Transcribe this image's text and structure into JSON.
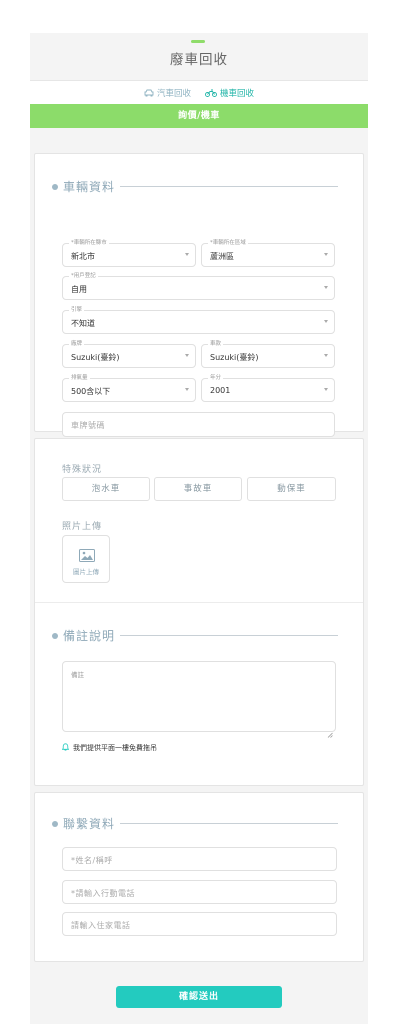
{
  "header": {
    "title": "廢車回收"
  },
  "tabs": {
    "car": "汽車回收",
    "motorcycle": "機車回收"
  },
  "banner": {
    "text": "詢價/機車"
  },
  "vehicle": {
    "heading": "車輛資料",
    "city": {
      "label": "*車輛所在縣市",
      "value": "新北市"
    },
    "district": {
      "label": "*車輛所在區域",
      "value": "蘆洲區"
    },
    "user_type": {
      "label": "*用戶登記",
      "value": "自用"
    },
    "engine": {
      "label": "引擎",
      "value": "不知道"
    },
    "brand": {
      "label": "廠牌",
      "value": "Suzuki(臺鈴)"
    },
    "model": {
      "label": "車款",
      "value": "Suzuki(臺鈴)"
    },
    "displacement": {
      "label": "排氣量",
      "value": "500含以下"
    },
    "year": {
      "label": "年分",
      "value": "2001"
    },
    "plate_placeholder": "車牌號碼"
  },
  "special": {
    "heading": "特殊狀況",
    "options": [
      "泡水車",
      "事故車",
      "動保車"
    ],
    "photo_heading": "照片上傳",
    "photo_button": "圖片上傳"
  },
  "remarks": {
    "heading": "備註說明",
    "placeholder": "備註",
    "note": "我們提供平面一樓免費拖吊"
  },
  "contact": {
    "heading": "聯繫資料",
    "name_placeholder": "*姓名/稱呼",
    "mobile_placeholder": "*請輸入行動電話",
    "home_placeholder": "請輸入住家電話"
  },
  "submit_label": "確認送出",
  "colors": {
    "green": "#8cdc6a",
    "teal": "#23cbbf",
    "muted": "#8fa9b8"
  }
}
